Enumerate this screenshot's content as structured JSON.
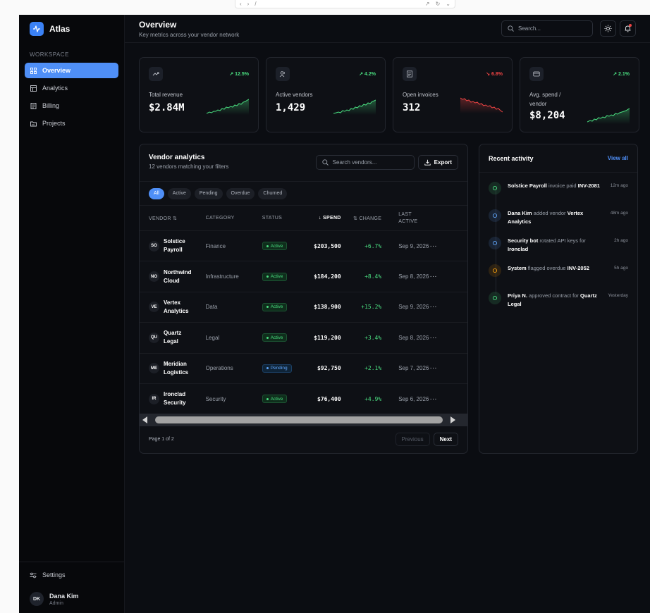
{
  "browser": {
    "url": "/"
  },
  "colors": {
    "accent": "#4f8ff7",
    "positive": "#4ade80",
    "negative": "#ef4444",
    "background": "#0b0d12"
  },
  "sidebar": {
    "app_name": "Atlas",
    "section_label": "WORKSPACE",
    "items": [
      {
        "label": "Overview",
        "icon": "grid-icon",
        "active": true
      },
      {
        "label": "Analytics",
        "icon": "table-icon",
        "active": false
      },
      {
        "label": "Billing",
        "icon": "file-text-icon",
        "active": false
      },
      {
        "label": "Projects",
        "icon": "folder-icon",
        "active": false
      }
    ],
    "settings_label": "Settings",
    "user": {
      "initials": "DK",
      "name": "Dana Kim",
      "role": "Admin"
    }
  },
  "header": {
    "title": "Overview",
    "subtitle": "Key metrics across your vendor network",
    "search_placeholder": "Search..."
  },
  "cards": [
    {
      "label": "Total revenue",
      "value": "$2.84M",
      "delta": "12.5%",
      "direction": "up",
      "icon": "trending-up-icon"
    },
    {
      "label": "Active vendors",
      "value": "1,429",
      "delta": "4.2%",
      "direction": "up",
      "icon": "users-icon"
    },
    {
      "label": "Open invoices",
      "value": "312",
      "delta": "6.8%",
      "direction": "down",
      "icon": "file-text-icon"
    },
    {
      "label": "Avg. spend / vendor",
      "value": "$8,204",
      "delta": "2.1%",
      "direction": "up",
      "icon": "credit-card-icon"
    }
  ],
  "vendors": {
    "title": "Vendor analytics",
    "subtitle": "12 vendors matching your filters",
    "search_placeholder": "Search vendors...",
    "export_label": "Export",
    "filters": [
      "All",
      "Active",
      "Pending",
      "Overdue",
      "Churned"
    ],
    "active_filter": "All",
    "columns": {
      "vendor": "VENDOR",
      "category": "CATEGORY",
      "status": "STATUS",
      "spend": "SPEND",
      "change": "CHANGE",
      "last_active": "LAST ACTIVE"
    },
    "rows": [
      {
        "initials": "SO",
        "name": "Solstice Payroll",
        "category": "Finance",
        "status": "Active",
        "spend": "$203,500",
        "change": "+6.7%",
        "date": "Sep 9, 2026"
      },
      {
        "initials": "NO",
        "name": "Northwind Cloud",
        "category": "Infrastructure",
        "status": "Active",
        "spend": "$184,200",
        "change": "+8.4%",
        "date": "Sep 8, 2026"
      },
      {
        "initials": "VE",
        "name": "Vertex Analytics",
        "category": "Data",
        "status": "Active",
        "spend": "$138,900",
        "change": "+15.2%",
        "date": "Sep 9, 2026"
      },
      {
        "initials": "QU",
        "name": "Quartz Legal",
        "category": "Legal",
        "status": "Active",
        "spend": "$119,200",
        "change": "+3.4%",
        "date": "Sep 8, 2026"
      },
      {
        "initials": "ME",
        "name": "Meridian Logistics",
        "category": "Operations",
        "status": "Pending",
        "spend": "$92,750",
        "change": "+2.1%",
        "date": "Sep 7, 2026"
      },
      {
        "initials": "IR",
        "name": "Ironclad Security",
        "category": "Security",
        "status": "Active",
        "spend": "$76,400",
        "change": "+4.9%",
        "date": "Sep 6, 2026"
      }
    ],
    "page_label": "Page 1 of 2",
    "prev_label": "Previous",
    "next_label": "Next"
  },
  "activity": {
    "title": "Recent activity",
    "view_all": "View all",
    "items": [
      {
        "actor": "Solstice Payroll",
        "action": " invoice paid ",
        "target": "INV-2081",
        "time": "12m ago",
        "color": "#4ade80"
      },
      {
        "actor": "Dana Kim",
        "action": " added vendor ",
        "target": "Vertex Analytics",
        "time": "48m ago",
        "color": "#60a5fa"
      },
      {
        "actor": "Security bot",
        "action": " rotated API keys for ",
        "target": "Ironclad",
        "time": "2h ago",
        "color": "#60a5fa"
      },
      {
        "actor": "System",
        "action": " flagged overdue ",
        "target": "INV-2052",
        "time": "5h ago",
        "color": "#f59e0b"
      },
      {
        "actor": "Priya N.",
        "action": " approved contract for ",
        "target": "Quartz Legal",
        "time": "Yesterday",
        "color": "#4ade80"
      }
    ]
  }
}
